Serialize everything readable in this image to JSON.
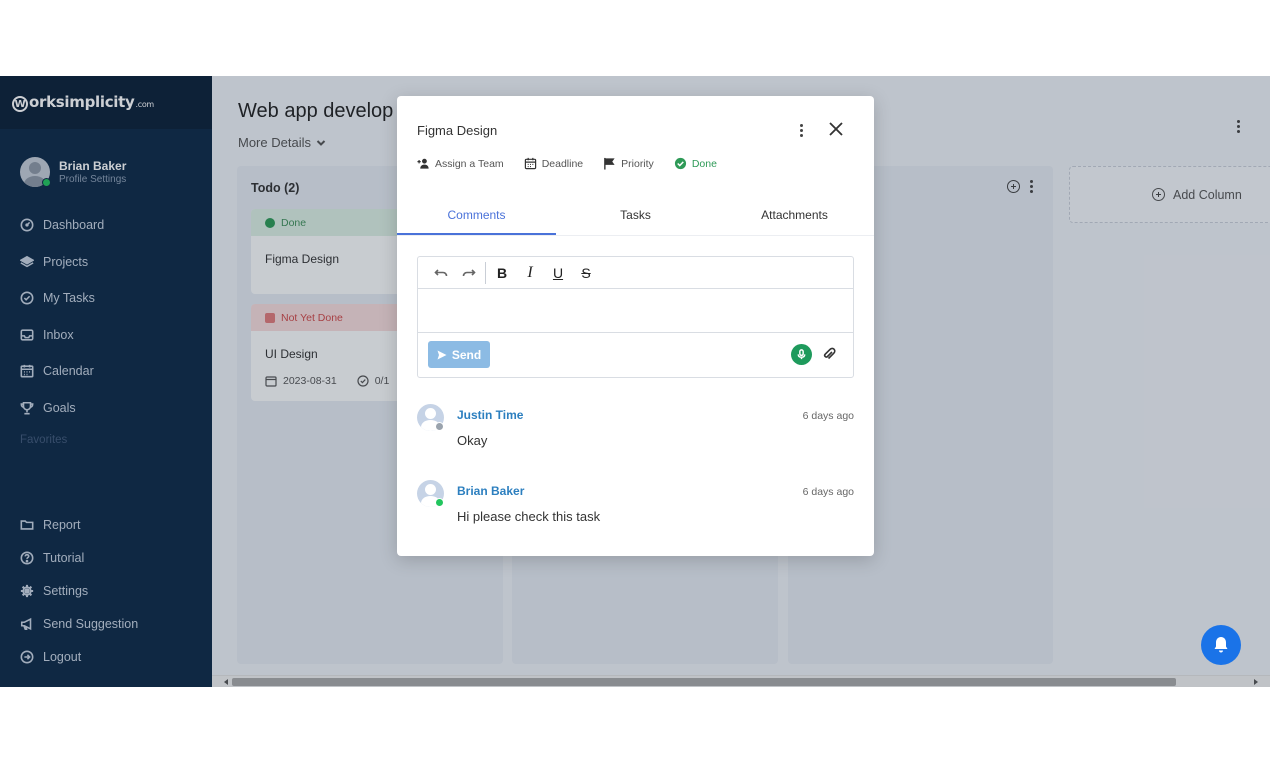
{
  "brand": {
    "logo_letter": "W",
    "name": "orksimplicity",
    "suffix": ".com"
  },
  "profile": {
    "name": "Brian Baker",
    "subtitle": "Profile Settings"
  },
  "sidebar": {
    "items": [
      {
        "label": "Dashboard",
        "icon": "dashboard-icon"
      },
      {
        "label": "Projects",
        "icon": "layers-icon"
      },
      {
        "label": "My Tasks",
        "icon": "check-circle-icon"
      },
      {
        "label": "Inbox",
        "icon": "inbox-icon"
      },
      {
        "label": "Calendar",
        "icon": "calendar-icon"
      },
      {
        "label": "Goals",
        "icon": "trophy-icon"
      }
    ],
    "favorites_label": "Favorites",
    "bottom_items": [
      {
        "label": "Report",
        "icon": "folder-icon"
      },
      {
        "label": "Tutorial",
        "icon": "help-icon"
      },
      {
        "label": "Settings",
        "icon": "gear-icon"
      },
      {
        "label": "Send Suggestion",
        "icon": "megaphone-icon"
      },
      {
        "label": "Logout",
        "icon": "logout-icon"
      }
    ]
  },
  "main": {
    "title": "Web app develop",
    "more_details": "More Details",
    "todo_column": {
      "header": "Todo (2)"
    },
    "cards": [
      {
        "status": "Done",
        "title": "Figma Design"
      },
      {
        "status": "Not Yet Done",
        "title": "UI Design",
        "date": "2023-08-31",
        "progress": "0/1"
      }
    ],
    "add_column": "Add Column"
  },
  "modal": {
    "title": "Figma Design",
    "meta": {
      "assign": "Assign a Team",
      "deadline": "Deadline",
      "priority": "Priority",
      "status": "Done"
    },
    "tabs": [
      {
        "label": "Comments"
      },
      {
        "label": "Tasks"
      },
      {
        "label": "Attachments"
      }
    ],
    "send_label": "Send",
    "comments": [
      {
        "author": "Justin Time",
        "time": "6 days ago",
        "text": "Okay"
      },
      {
        "author": "Brian Baker",
        "time": "6 days ago",
        "text": "Hi please check this task"
      }
    ]
  },
  "colors": {
    "sidebar": "#0e2a47",
    "accent": "#4a72d9",
    "done": "#2e9a57",
    "not_done": "#d04848",
    "link": "#2c7fbf"
  }
}
